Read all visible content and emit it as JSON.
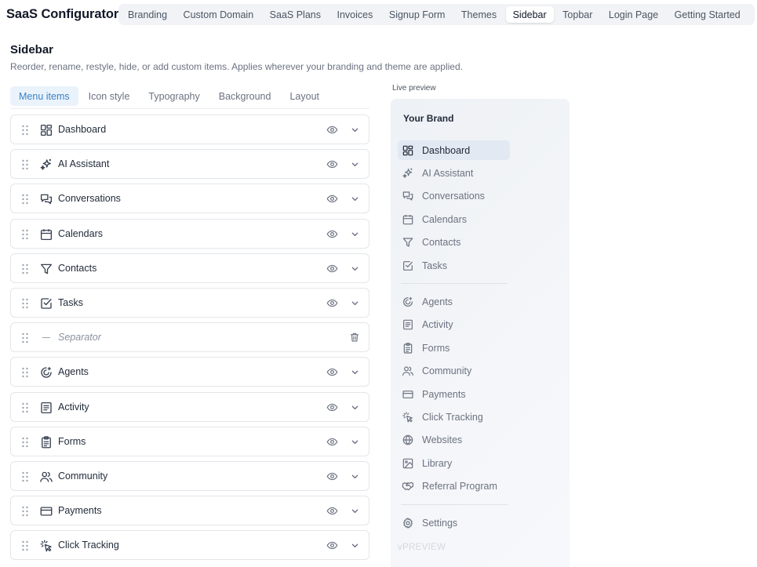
{
  "app": {
    "title": "SaaS Configurator"
  },
  "nav": {
    "tabs": [
      {
        "label": "Branding"
      },
      {
        "label": "Custom Domain"
      },
      {
        "label": "SaaS Plans"
      },
      {
        "label": "Invoices"
      },
      {
        "label": "Signup Form"
      },
      {
        "label": "Themes"
      },
      {
        "label": "Sidebar",
        "active": true
      },
      {
        "label": "Topbar"
      },
      {
        "label": "Login Page"
      },
      {
        "label": "Getting Started"
      }
    ]
  },
  "page": {
    "title": "Sidebar",
    "subtitle": "Reorder, rename, restyle, hide, or add custom items. Applies wherever your branding and theme are applied."
  },
  "subtabs": [
    {
      "label": "Menu items",
      "active": true
    },
    {
      "label": "Icon style"
    },
    {
      "label": "Typography"
    },
    {
      "label": "Background"
    },
    {
      "label": "Layout"
    }
  ],
  "menu_items": [
    {
      "label": "Dashboard",
      "icon": "dashboard-icon"
    },
    {
      "label": "AI Assistant",
      "icon": "sparkles-icon"
    },
    {
      "label": "Conversations",
      "icon": "chat-icon"
    },
    {
      "label": "Calendars",
      "icon": "calendar-icon"
    },
    {
      "label": "Contacts",
      "icon": "funnel-icon"
    },
    {
      "label": "Tasks",
      "icon": "checkbox-icon"
    },
    {
      "label": "Separator",
      "icon": "separator-icon",
      "separator": true
    },
    {
      "label": "Agents",
      "icon": "agents-icon"
    },
    {
      "label": "Activity",
      "icon": "activity-icon"
    },
    {
      "label": "Forms",
      "icon": "clipboard-icon"
    },
    {
      "label": "Community",
      "icon": "users-icon"
    },
    {
      "label": "Payments",
      "icon": "card-icon"
    },
    {
      "label": "Click Tracking",
      "icon": "click-icon"
    }
  ],
  "preview": {
    "label": "Live preview",
    "brand": "Your Brand",
    "items": [
      {
        "label": "Dashboard",
        "icon": "dashboard-icon",
        "active": true
      },
      {
        "label": "AI Assistant",
        "icon": "sparkles-icon"
      },
      {
        "label": "Conversations",
        "icon": "chat-icon"
      },
      {
        "label": "Calendars",
        "icon": "calendar-icon"
      },
      {
        "label": "Contacts",
        "icon": "funnel-icon"
      },
      {
        "label": "Tasks",
        "icon": "checkbox-icon"
      },
      {
        "label": "Agents",
        "icon": "agents-icon"
      },
      {
        "label": "Activity",
        "icon": "activity-icon"
      },
      {
        "label": "Forms",
        "icon": "clipboard-icon"
      },
      {
        "label": "Community",
        "icon": "users-icon"
      },
      {
        "label": "Payments",
        "icon": "card-icon"
      },
      {
        "label": "Click Tracking",
        "icon": "click-icon"
      },
      {
        "label": "Websites",
        "icon": "globe-icon"
      },
      {
        "label": "Library",
        "icon": "image-icon"
      },
      {
        "label": "Referral Program",
        "icon": "handshake-icon"
      },
      {
        "label": "Settings",
        "icon": "gear-icon"
      }
    ],
    "watermark": "vPREVIEW"
  },
  "colors": {
    "accent": "#3b82c4",
    "active_tab_bg": "#eaf3fc",
    "preview_active_bg": "#e2e9f3"
  }
}
